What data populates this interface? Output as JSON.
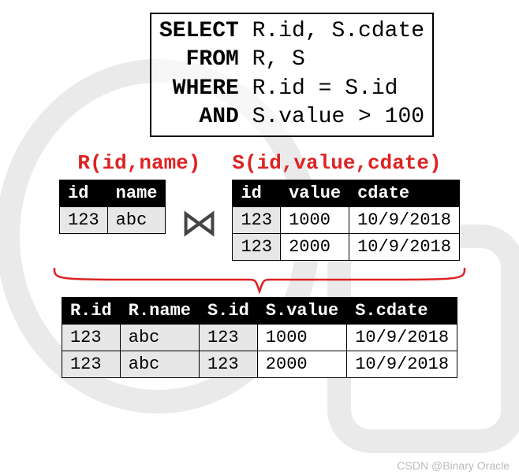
{
  "sql": {
    "l1a": "SELECT",
    "l1b": " R.id, S.cdate",
    "l2a": "  FROM",
    "l2b": " R, S",
    "l3a": " WHERE",
    "l3b": " R.id = S.id",
    "l4a": "   AND",
    "l4b": " S.value > 100"
  },
  "schemas": {
    "r": "R(id,name)",
    "s": "S(id,value,cdate)"
  },
  "tableR": {
    "headers": [
      "id",
      "name"
    ],
    "rows": [
      [
        "123",
        "abc"
      ]
    ]
  },
  "tableS": {
    "headers": [
      "id",
      "value",
      "cdate"
    ],
    "rows": [
      [
        "123",
        "1000",
        "10/9/2018"
      ],
      [
        "123",
        "2000",
        "10/9/2018"
      ]
    ]
  },
  "join_symbol": "⋈",
  "result": {
    "headers": [
      "R.id",
      "R.name",
      "S.id",
      "S.value",
      "S.cdate"
    ],
    "rows": [
      [
        "123",
        "abc",
        "123",
        "1000",
        "10/9/2018"
      ],
      [
        "123",
        "abc",
        "123",
        "2000",
        "10/9/2018"
      ]
    ]
  },
  "watermark": "CSDN @Binary Oracle"
}
